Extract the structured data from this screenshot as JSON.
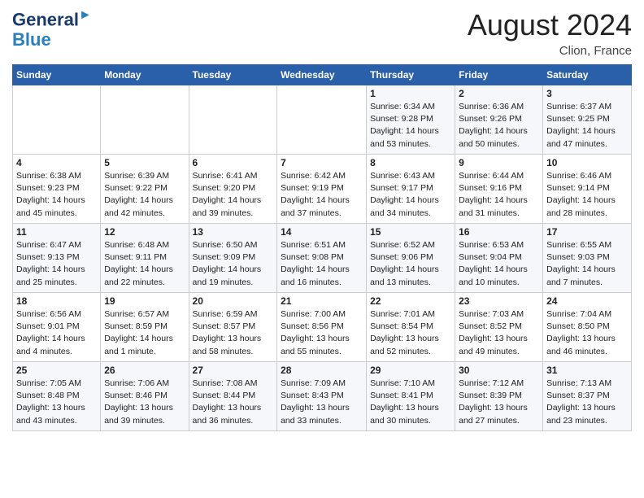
{
  "header": {
    "logo_line1": "General",
    "logo_line2": "Blue",
    "month_year": "August 2024",
    "location": "Clion, France"
  },
  "days_of_week": [
    "Sunday",
    "Monday",
    "Tuesday",
    "Wednesday",
    "Thursday",
    "Friday",
    "Saturday"
  ],
  "weeks": [
    [
      {
        "day": "",
        "info": ""
      },
      {
        "day": "",
        "info": ""
      },
      {
        "day": "",
        "info": ""
      },
      {
        "day": "",
        "info": ""
      },
      {
        "day": "1",
        "info": "Sunrise: 6:34 AM\nSunset: 9:28 PM\nDaylight: 14 hours\nand 53 minutes."
      },
      {
        "day": "2",
        "info": "Sunrise: 6:36 AM\nSunset: 9:26 PM\nDaylight: 14 hours\nand 50 minutes."
      },
      {
        "day": "3",
        "info": "Sunrise: 6:37 AM\nSunset: 9:25 PM\nDaylight: 14 hours\nand 47 minutes."
      }
    ],
    [
      {
        "day": "4",
        "info": "Sunrise: 6:38 AM\nSunset: 9:23 PM\nDaylight: 14 hours\nand 45 minutes."
      },
      {
        "day": "5",
        "info": "Sunrise: 6:39 AM\nSunset: 9:22 PM\nDaylight: 14 hours\nand 42 minutes."
      },
      {
        "day": "6",
        "info": "Sunrise: 6:41 AM\nSunset: 9:20 PM\nDaylight: 14 hours\nand 39 minutes."
      },
      {
        "day": "7",
        "info": "Sunrise: 6:42 AM\nSunset: 9:19 PM\nDaylight: 14 hours\nand 37 minutes."
      },
      {
        "day": "8",
        "info": "Sunrise: 6:43 AM\nSunset: 9:17 PM\nDaylight: 14 hours\nand 34 minutes."
      },
      {
        "day": "9",
        "info": "Sunrise: 6:44 AM\nSunset: 9:16 PM\nDaylight: 14 hours\nand 31 minutes."
      },
      {
        "day": "10",
        "info": "Sunrise: 6:46 AM\nSunset: 9:14 PM\nDaylight: 14 hours\nand 28 minutes."
      }
    ],
    [
      {
        "day": "11",
        "info": "Sunrise: 6:47 AM\nSunset: 9:13 PM\nDaylight: 14 hours\nand 25 minutes."
      },
      {
        "day": "12",
        "info": "Sunrise: 6:48 AM\nSunset: 9:11 PM\nDaylight: 14 hours\nand 22 minutes."
      },
      {
        "day": "13",
        "info": "Sunrise: 6:50 AM\nSunset: 9:09 PM\nDaylight: 14 hours\nand 19 minutes."
      },
      {
        "day": "14",
        "info": "Sunrise: 6:51 AM\nSunset: 9:08 PM\nDaylight: 14 hours\nand 16 minutes."
      },
      {
        "day": "15",
        "info": "Sunrise: 6:52 AM\nSunset: 9:06 PM\nDaylight: 14 hours\nand 13 minutes."
      },
      {
        "day": "16",
        "info": "Sunrise: 6:53 AM\nSunset: 9:04 PM\nDaylight: 14 hours\nand 10 minutes."
      },
      {
        "day": "17",
        "info": "Sunrise: 6:55 AM\nSunset: 9:03 PM\nDaylight: 14 hours\nand 7 minutes."
      }
    ],
    [
      {
        "day": "18",
        "info": "Sunrise: 6:56 AM\nSunset: 9:01 PM\nDaylight: 14 hours\nand 4 minutes."
      },
      {
        "day": "19",
        "info": "Sunrise: 6:57 AM\nSunset: 8:59 PM\nDaylight: 14 hours\nand 1 minute."
      },
      {
        "day": "20",
        "info": "Sunrise: 6:59 AM\nSunset: 8:57 PM\nDaylight: 13 hours\nand 58 minutes."
      },
      {
        "day": "21",
        "info": "Sunrise: 7:00 AM\nSunset: 8:56 PM\nDaylight: 13 hours\nand 55 minutes."
      },
      {
        "day": "22",
        "info": "Sunrise: 7:01 AM\nSunset: 8:54 PM\nDaylight: 13 hours\nand 52 minutes."
      },
      {
        "day": "23",
        "info": "Sunrise: 7:03 AM\nSunset: 8:52 PM\nDaylight: 13 hours\nand 49 minutes."
      },
      {
        "day": "24",
        "info": "Sunrise: 7:04 AM\nSunset: 8:50 PM\nDaylight: 13 hours\nand 46 minutes."
      }
    ],
    [
      {
        "day": "25",
        "info": "Sunrise: 7:05 AM\nSunset: 8:48 PM\nDaylight: 13 hours\nand 43 minutes."
      },
      {
        "day": "26",
        "info": "Sunrise: 7:06 AM\nSunset: 8:46 PM\nDaylight: 13 hours\nand 39 minutes."
      },
      {
        "day": "27",
        "info": "Sunrise: 7:08 AM\nSunset: 8:44 PM\nDaylight: 13 hours\nand 36 minutes."
      },
      {
        "day": "28",
        "info": "Sunrise: 7:09 AM\nSunset: 8:43 PM\nDaylight: 13 hours\nand 33 minutes."
      },
      {
        "day": "29",
        "info": "Sunrise: 7:10 AM\nSunset: 8:41 PM\nDaylight: 13 hours\nand 30 minutes."
      },
      {
        "day": "30",
        "info": "Sunrise: 7:12 AM\nSunset: 8:39 PM\nDaylight: 13 hours\nand 27 minutes."
      },
      {
        "day": "31",
        "info": "Sunrise: 7:13 AM\nSunset: 8:37 PM\nDaylight: 13 hours\nand 23 minutes."
      }
    ]
  ]
}
